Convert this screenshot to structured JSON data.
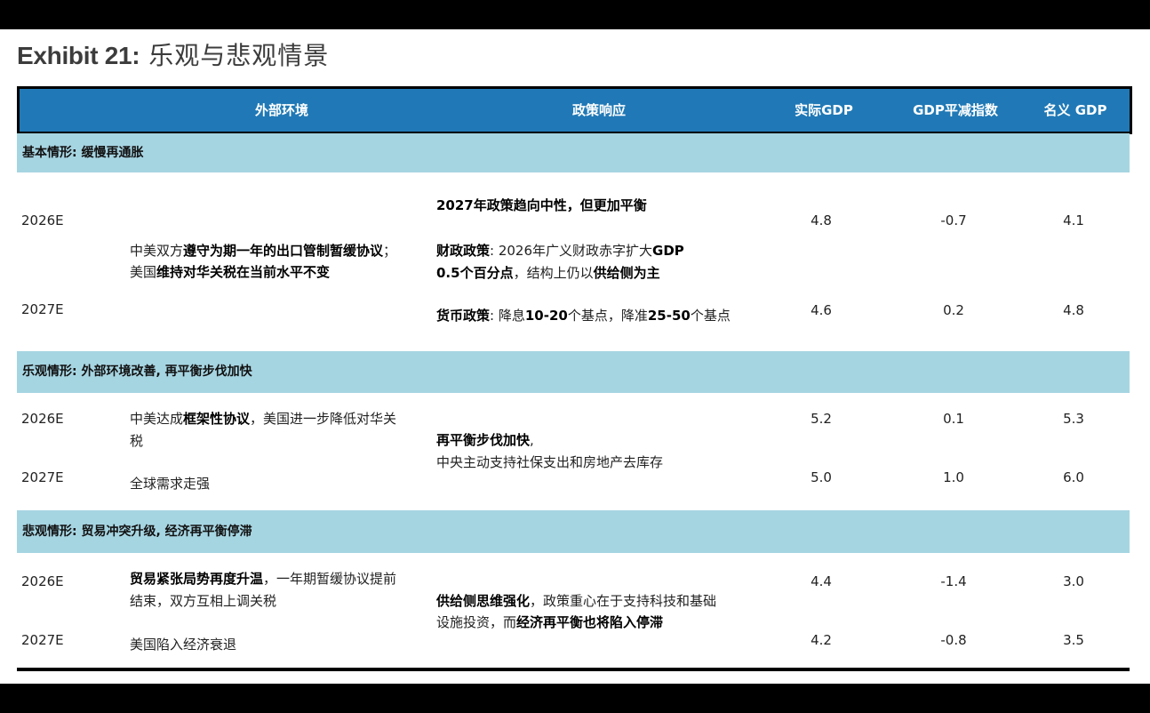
{
  "title": {
    "exhibit": "Exhibit 21:",
    "text": "乐观与悲观情景"
  },
  "header": {
    "external": "外部环境",
    "policy": "政策响应",
    "real_gdp": "实际GDP",
    "deflator": "GDP平减指数",
    "nominal": "名义 GDP"
  },
  "base": {
    "label": "基本情形: 缓慢再通胀",
    "y1": "2026E",
    "y2": "2027E",
    "ext_line1_a": "中美双方",
    "ext_line1_b": "遵守为期一年的出口管制暂缓协议",
    "ext_line1_c": "；",
    "ext_line2_a": "美国",
    "ext_line2_b": "维持对华关税在当前水平不变",
    "pol_title": "2027年政策趋向中性，但更加平衡",
    "pol_fiscal_a": "财政政策",
    "pol_fiscal_b": ": 2026年广义财政赤字扩大",
    "pol_fiscal_c": "GDP",
    "pol_fiscal2_a": "0.5个百分点",
    "pol_fiscal2_b": "，结构上仍以",
    "pol_fiscal2_c": "供给侧为主",
    "pol_mon_a": "货币政策",
    "pol_mon_b": ": 降息",
    "pol_mon_c": "10-20",
    "pol_mon_d": "个基点，降准",
    "pol_mon_e": "25-50",
    "pol_mon_f": "个基点",
    "r1": {
      "real": "4.8",
      "defl": "-0.7",
      "nom": "4.1"
    },
    "r2": {
      "real": "4.6",
      "defl": "0.2",
      "nom": "4.8"
    }
  },
  "optimistic": {
    "label": "乐观情形: 外部环境改善, 再平衡步伐加快",
    "y1": "2026E",
    "y2": "2027E",
    "ext1_a": "中美达成",
    "ext1_b": "框架性协议",
    "ext1_c": "，美国进一步降低对华关",
    "ext1_d": "税",
    "ext2": "全球需求走强",
    "pol1": "再平衡步伐加快",
    "pol1_b": ",",
    "pol2": "中央主动支持社保支出和房地产去库存",
    "r1": {
      "real": "5.2",
      "defl": "0.1",
      "nom": "5.3"
    },
    "r2": {
      "real": "5.0",
      "defl": "1.0",
      "nom": "6.0"
    }
  },
  "pessimistic": {
    "label": "悲观情形: 贸易冲突升级, 经济再平衡停滞",
    "y1": "2026E",
    "y2": "2027E",
    "ext1_a": "贸易紧张局势再度升温",
    "ext1_b": "，一年期暂缓协议提前",
    "ext1_c": "结束，双方互相上调关税",
    "ext2": "美国陷入经济衰退",
    "pol1_a": "供给侧思维强化",
    "pol1_b": "，政策重心在于支持科技和基础",
    "pol2_a": "设施投资，而",
    "pol2_b": "经济再平衡也将陷入停滞",
    "r1": {
      "real": "4.4",
      "defl": "-1.4",
      "nom": "3.0"
    },
    "r2": {
      "real": "4.2",
      "defl": "-0.8",
      "nom": "3.5"
    }
  }
}
